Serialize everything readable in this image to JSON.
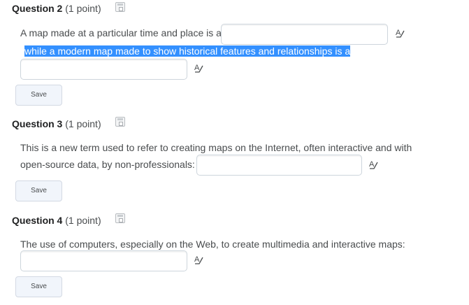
{
  "questions": [
    {
      "name": "Question 2",
      "points": "(1 point)",
      "text_line1": "A map made at a particular time and place is a",
      "text_line2_highlighted": "while a modern map made to show historical features and relationships is a",
      "blank1_value": "",
      "blank2_value": "",
      "save_label": "Save"
    },
    {
      "name": "Question 3",
      "points": "(1 point)",
      "text_line1": "This is a new term used to refer to creating maps on the Internet, often interactive and with",
      "text_line2": "open-source data, by non-professionals:",
      "blank1_value": "",
      "save_label": "Save"
    },
    {
      "name": "Question 4",
      "points": "(1 point)",
      "text_line1": "The use of computers, especially on the Web, to create multimedia and interactive maps:",
      "blank1_value": "",
      "save_label": "Save"
    }
  ],
  "icons": {
    "flag": "flag-question-icon",
    "spell": "spell-check-icon"
  },
  "colors": {
    "highlight": "#3390ff",
    "title": "#202122",
    "text": "#494c4e",
    "border": "#cdd5dc",
    "button_bg": "#f1f5fb"
  }
}
